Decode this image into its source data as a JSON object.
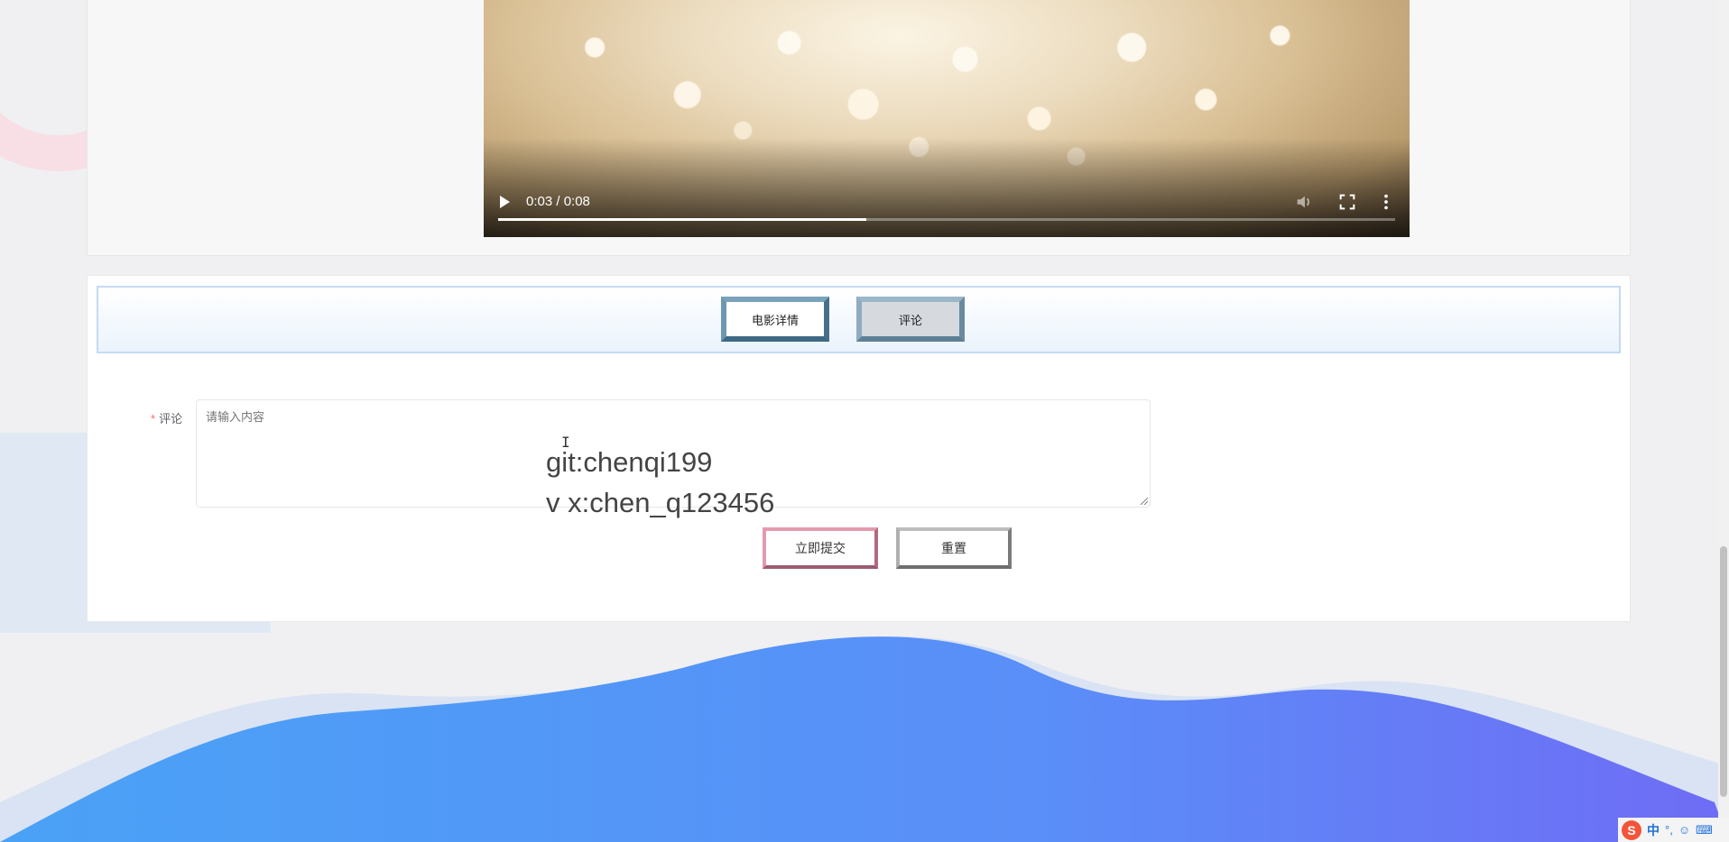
{
  "video": {
    "time_display": "0:03 / 0:08",
    "progress": 0.41
  },
  "tabs": {
    "detail_label": "电影详情",
    "comment_label": "评论"
  },
  "form": {
    "required_mark": "*",
    "comment_label": "评论",
    "comment_placeholder": "请输入内容",
    "submit_label": "立即提交",
    "reset_label": "重置"
  },
  "overlay": {
    "line1": "git:chenqi199",
    "line2": "v x:chen_q123456"
  },
  "ime": {
    "logo": "S",
    "mode": "中",
    "punct": "°,",
    "emoji": "☺",
    "keyboard": "⌨"
  },
  "colors": {
    "accent_blue": "#4f8ef7",
    "wave_purple": "#6a6ef5",
    "tab_border": "#5a86a0",
    "submit_border": "#e39aaf"
  }
}
